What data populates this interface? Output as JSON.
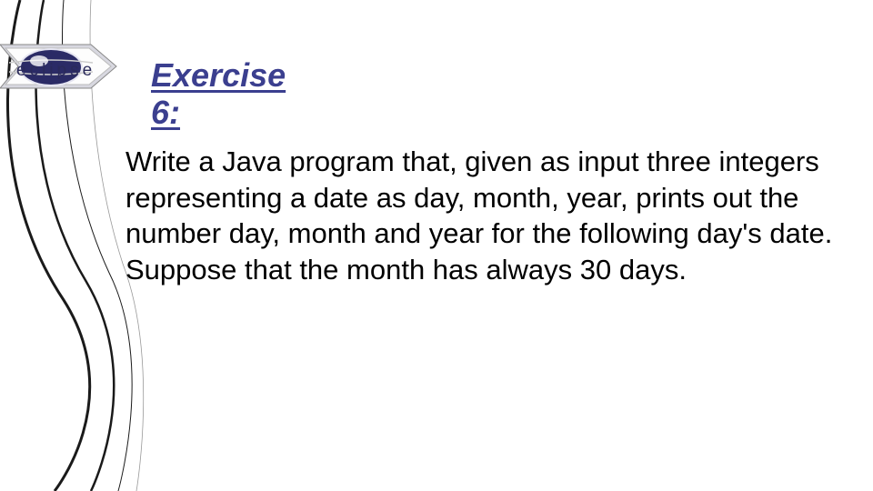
{
  "logo": {
    "text": "eclipse"
  },
  "slide": {
    "title_line1": "Exercise",
    "title_line2": "6:",
    "body": "Write a Java program that, given as input three integers representing a date as day, month, year, prints out the number day, month and year for the following day's date.\nSuppose that the month has always 30 days."
  }
}
